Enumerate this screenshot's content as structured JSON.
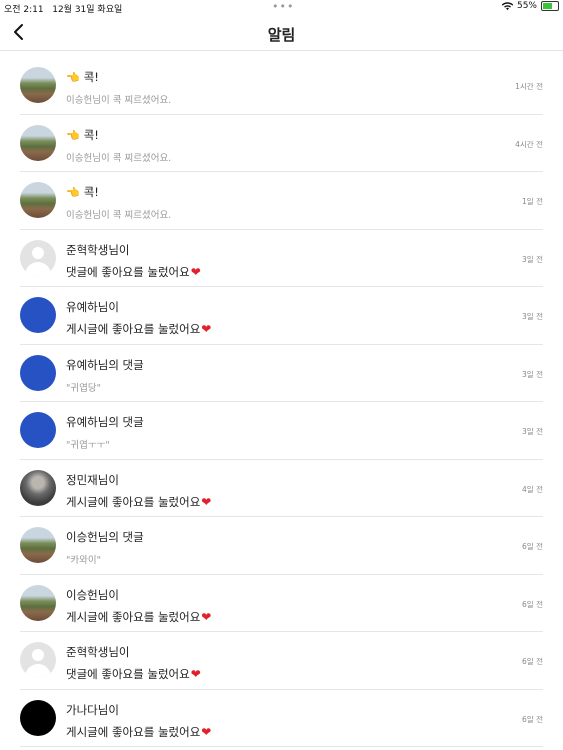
{
  "status": {
    "time": "오전 2:11",
    "date": "12월 31일 화요일",
    "battery": "55%",
    "dots": "•••"
  },
  "header": {
    "title": "알림"
  },
  "notifications": [
    {
      "avatar": "landscape",
      "hand": "👈",
      "line1": "콕!",
      "line2": "이승헌님이 콕 찌르셨어요.",
      "time": "1시간 전"
    },
    {
      "avatar": "landscape",
      "hand": "👈",
      "line1": "콕!",
      "line2": "이승헌님이 콕 찌르셨어요.",
      "time": "4시간 전"
    },
    {
      "avatar": "landscape",
      "hand": "👈",
      "line1": "콕!",
      "line2": "이승헌님이 콕 찌르셨어요.",
      "time": "1일 전"
    },
    {
      "avatar": "gray",
      "line1": "준혁학생님이",
      "line2": "댓글에 좋아요를 눌렀어요",
      "heart": "❤",
      "time": "3일 전"
    },
    {
      "avatar": "blue",
      "line1": "유예하님이",
      "line2": "게시글에 좋아요를 눌렀어요",
      "heart": "❤",
      "time": "3일 전"
    },
    {
      "avatar": "blue",
      "line1": "유예하님의 댓글",
      "line2": "\"귀엽당\"",
      "time": "3일 전"
    },
    {
      "avatar": "blue",
      "line1": "유예하님의 댓글",
      "line2": "\"귀엽ㅜㅜ\"",
      "time": "3일 전"
    },
    {
      "avatar": "photo",
      "line1": "정민재님이",
      "line2": "게시글에 좋아요를 눌렀어요",
      "heart": "❤",
      "time": "4일 전"
    },
    {
      "avatar": "landscape",
      "line1": "이승헌님의 댓글",
      "line2": "\"카와이\"",
      "time": "6일 전"
    },
    {
      "avatar": "landscape",
      "line1": "이승헌님이",
      "line2": "게시글에 좋아요를 눌렀어요",
      "heart": "❤",
      "time": "6일 전"
    },
    {
      "avatar": "gray",
      "line1": "준혁학생님이",
      "line2": "댓글에 좋아요를 눌렀어요",
      "heart": "❤",
      "time": "6일 전"
    },
    {
      "avatar": "black",
      "line1": "가나다님이",
      "line2": "게시글에 좋아요를 눌렀어요",
      "heart": "❤",
      "time": "6일 전"
    }
  ]
}
